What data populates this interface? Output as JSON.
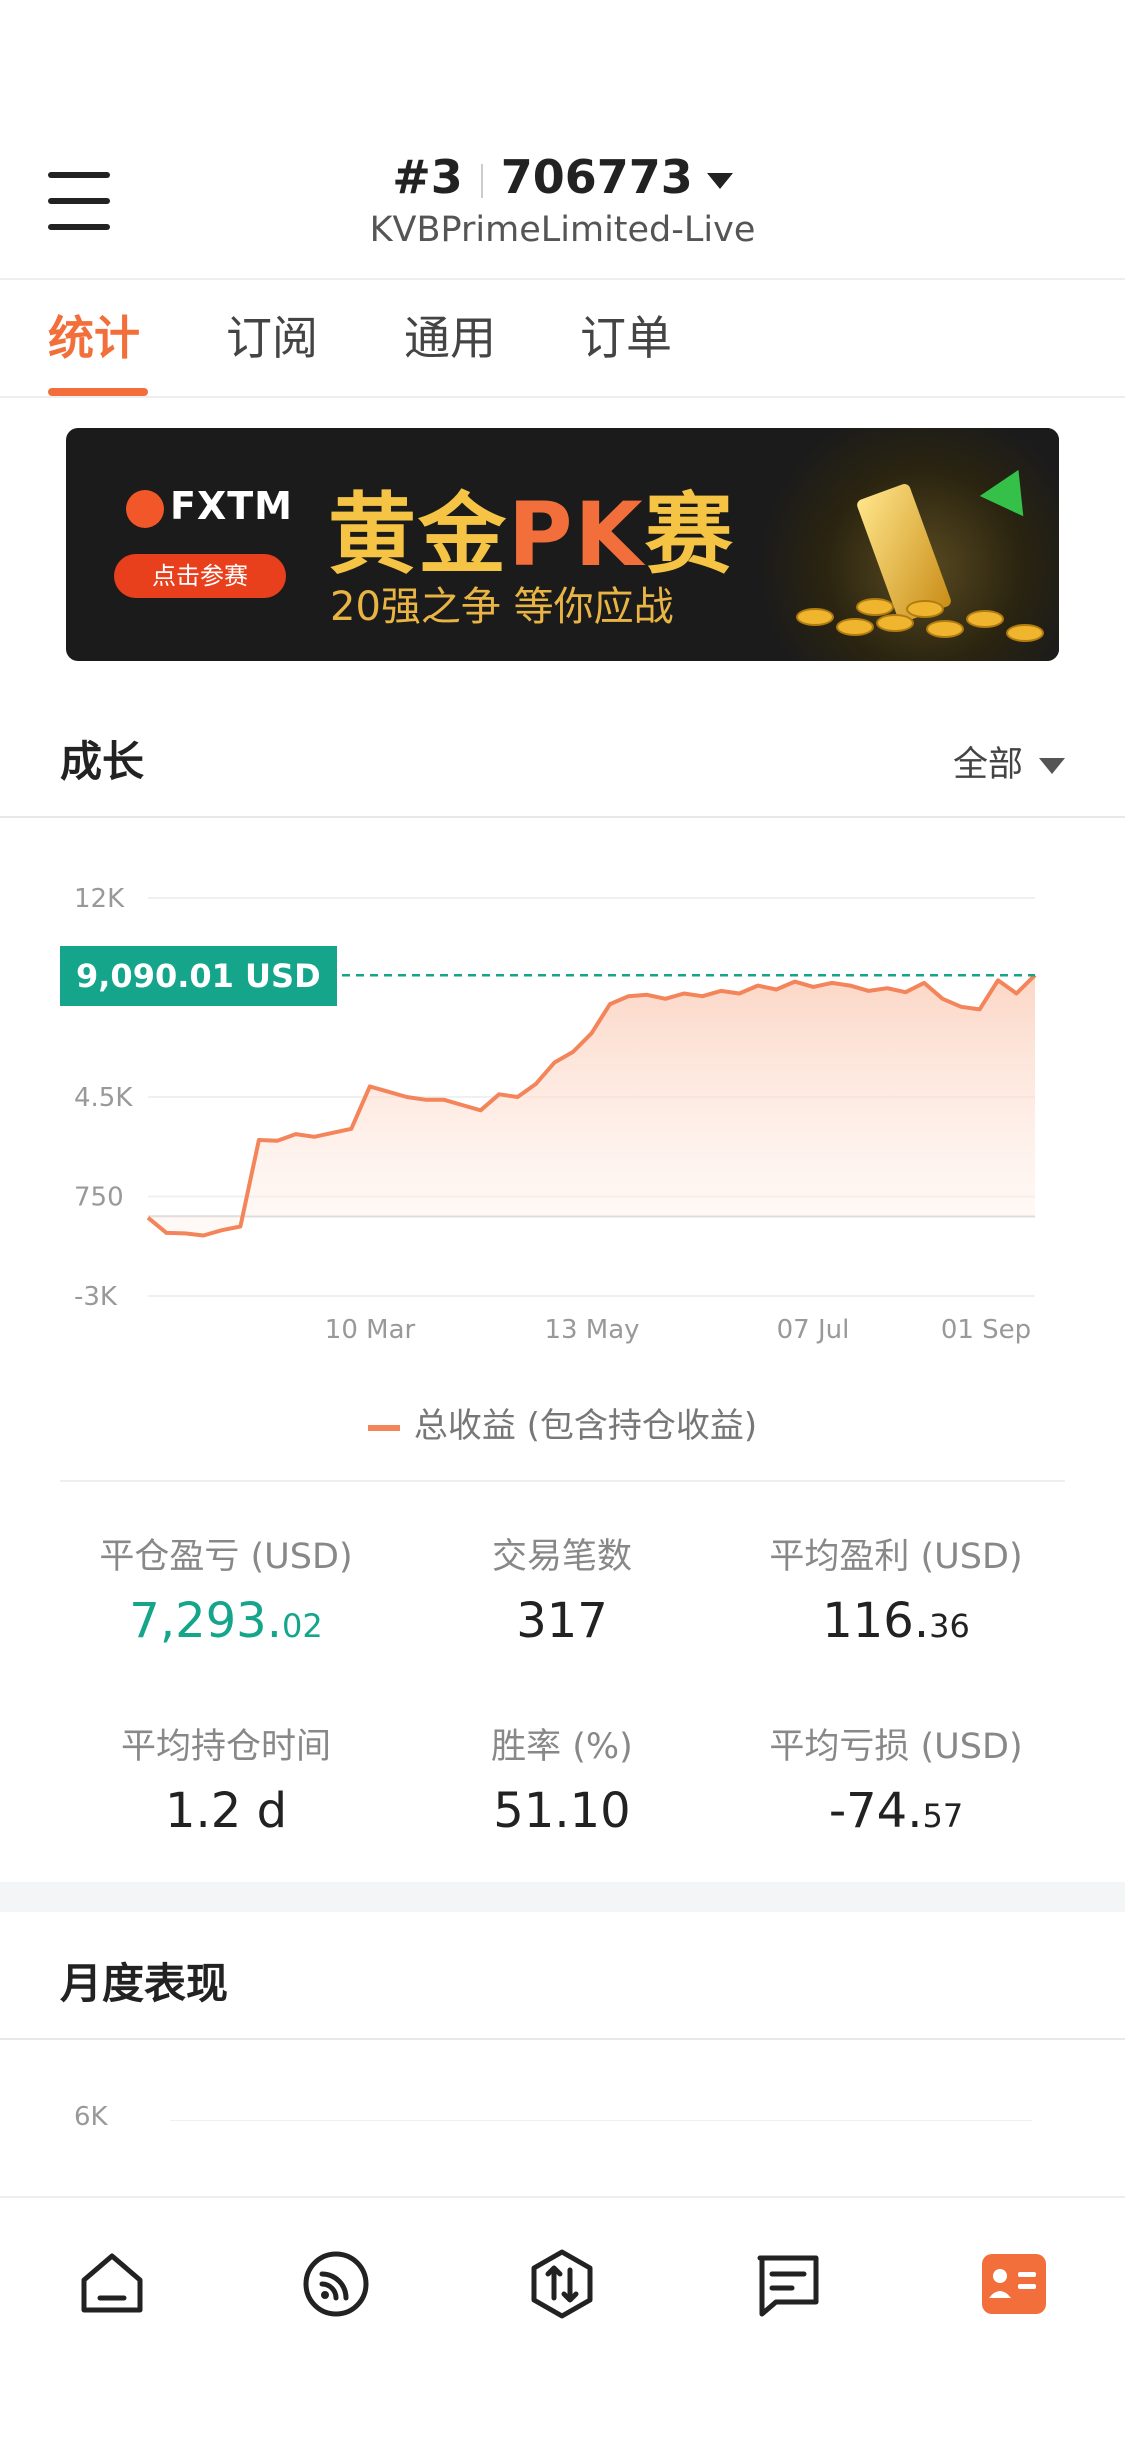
{
  "header": {
    "account_num": "#3",
    "account_id": "706773",
    "broker": "KVBPrimeLimited-Live"
  },
  "tabs": [
    {
      "label": "统计",
      "active": true
    },
    {
      "label": "订阅",
      "active": false
    },
    {
      "label": "通用",
      "active": false
    },
    {
      "label": "订单",
      "active": false
    }
  ],
  "banner": {
    "brand": "FXTM",
    "button": "点击参赛",
    "title_part1": "黄金",
    "title_part2": "PK",
    "title_part3": "赛",
    "subtitle": "20强之争  等你应战"
  },
  "growth": {
    "title": "成长",
    "filter": "全部"
  },
  "chart_data": {
    "type": "area",
    "y_ticks": [
      "12K",
      "4.5K",
      "750",
      "-3K"
    ],
    "x_ticks": [
      "10 Mar",
      "13 May",
      "07 Jul",
      "01 Sep"
    ],
    "ylim": [
      -3000,
      12000
    ],
    "current_value_label": "9,090.01 USD",
    "current_value": 9090.01,
    "series": [
      {
        "name": "总收益 (包含持仓收益)",
        "color": "#f4845a",
        "values": [
          -50,
          -620,
          -640,
          -720,
          -520,
          -380,
          2880,
          2850,
          3100,
          3000,
          3150,
          3300,
          4900,
          4700,
          4500,
          4400,
          4400,
          4200,
          4000,
          4600,
          4500,
          5000,
          5800,
          6200,
          6900,
          8000,
          8300,
          8350,
          8200,
          8400,
          8300,
          8500,
          8400,
          8700,
          8550,
          8850,
          8650,
          8800,
          8700,
          8500,
          8600,
          8450,
          8800,
          8200,
          7900,
          7800,
          8900,
          8400,
          9090
        ]
      }
    ],
    "legend": "总收益 (包含持仓收益)"
  },
  "stats": [
    {
      "label": "平仓盈亏 (USD)",
      "int": "7,293.",
      "dec": "02",
      "color": "green"
    },
    {
      "label": "交易笔数",
      "int": "317",
      "dec": "",
      "color": "normal"
    },
    {
      "label": "平均盈利 (USD)",
      "int": "116.",
      "dec": "36",
      "color": "normal"
    },
    {
      "label": "平均持仓时间",
      "int": "1.2 d",
      "dec": "",
      "color": "normal"
    },
    {
      "label": "胜率 (%)",
      "int": "51.10",
      "dec": "",
      "color": "normal"
    },
    {
      "label": "平均亏损 (USD)",
      "int": "-74.",
      "dec": "57",
      "color": "normal"
    }
  ],
  "monthly": {
    "title": "月度表现",
    "y_tick": "6K"
  },
  "bottom_nav": [
    {
      "icon": "home-icon"
    },
    {
      "icon": "signal-icon"
    },
    {
      "icon": "trade-icon"
    },
    {
      "icon": "message-icon"
    },
    {
      "icon": "profile-icon",
      "active": true
    }
  ],
  "colors": {
    "accent": "#f26f3b",
    "green": "#14a58b"
  }
}
